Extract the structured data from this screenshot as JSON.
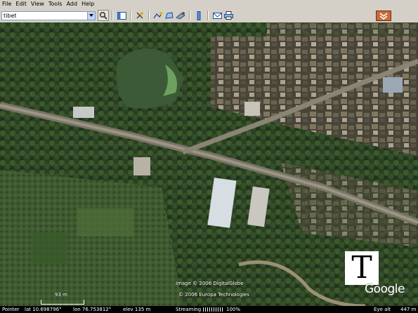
{
  "menu": [
    "File",
    "Edit",
    "View",
    "Tools",
    "Add",
    "Help"
  ],
  "search": {
    "value": "tibet"
  },
  "toolbar": {
    "icons": [
      "search-go-icon",
      "sidebar-icon",
      "placemark-icon",
      "path-icon",
      "polygon-icon",
      "overlay-icon",
      "ruler-icon",
      "email-icon",
      "print-icon"
    ]
  },
  "map": {
    "credits": [
      "Image © 2006 DigitalGlobe",
      "© 2006 Europa Technologies"
    ],
    "scale_label": "93 m",
    "logo_letter": "T",
    "brand": "Google"
  },
  "status": {
    "pointer": "Pointer",
    "lat": "lat  10.698796°",
    "lon": "lon  76.753812°",
    "elev": "elev  135 m",
    "streaming": "Streaming",
    "streaming_pct": "100%",
    "eye_alt_label": "Eye alt",
    "eye_alt_value": "447 m"
  },
  "colors": {
    "chrome": "#d4d0c8",
    "status_bg": "#000000"
  }
}
